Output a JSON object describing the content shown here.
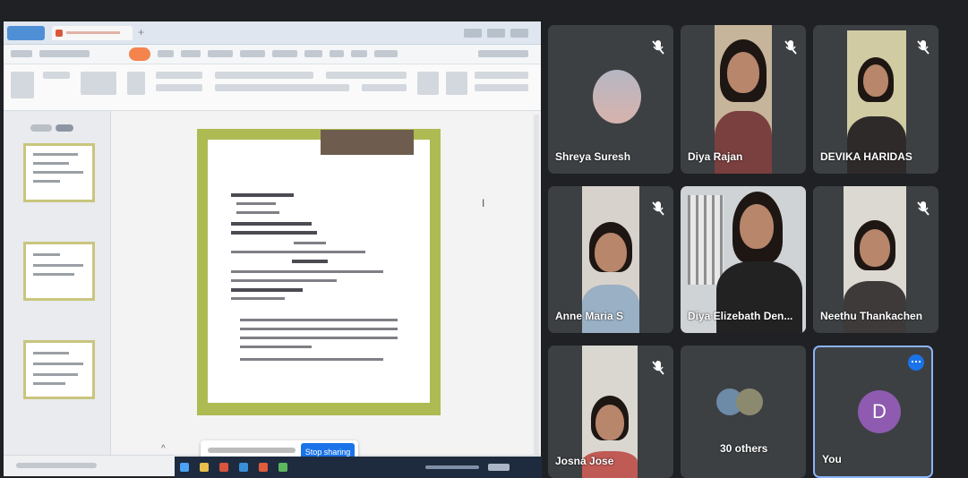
{
  "presentation": {
    "stop_sharing_label": "Stop sharing",
    "new_tab_symbol": "+",
    "banner_close_symbol": "^"
  },
  "participants": [
    {
      "name": "Shreya Suresh",
      "muted": true
    },
    {
      "name": "Diya Rajan",
      "muted": true
    },
    {
      "name": "DEVIKA HARIDAS",
      "muted": true
    },
    {
      "name": "Anne Maria S",
      "muted": true
    },
    {
      "name": "Diya Elizebath Den...",
      "muted": false
    },
    {
      "name": "Neethu Thankachen",
      "muted": true
    },
    {
      "name": "Josna Jose",
      "muted": true
    },
    {
      "name": "30 others",
      "muted": false
    },
    {
      "name": "You",
      "muted": false
    }
  ],
  "self": {
    "initial": "D",
    "avatar_color": "#8e5bb0"
  },
  "colors": {
    "tile_bg": "#3c4043",
    "slide_border": "#adbb52",
    "accent_blue": "#1a73e8",
    "wps_orange": "#f4834e"
  }
}
